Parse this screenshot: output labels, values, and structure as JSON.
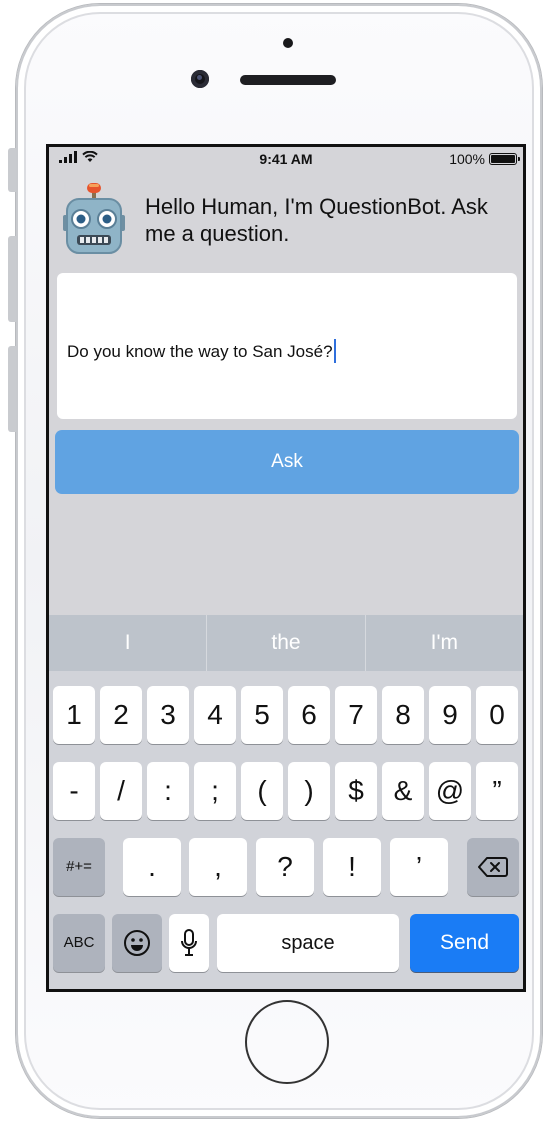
{
  "status_bar": {
    "time": "9:41 AM",
    "battery_percent": "100%",
    "icons": [
      "signal-bars-icon",
      "wifi-icon",
      "battery-icon"
    ]
  },
  "bot": {
    "avatar": "robot-face-icon",
    "greeting": "Hello Human, I'm QuestionBot. Ask me a question."
  },
  "question": {
    "value": "Do you know the way to San José?"
  },
  "ask_button": {
    "label": "Ask",
    "color": "#60a3e2"
  },
  "keyboard": {
    "suggestions": [
      "I",
      "the",
      "I'm"
    ],
    "row1": [
      "1",
      "2",
      "3",
      "4",
      "5",
      "6",
      "7",
      "8",
      "9",
      "0"
    ],
    "row2": [
      "-",
      "/",
      ":",
      ";",
      "(",
      ")",
      "$",
      "&",
      "@",
      "”"
    ],
    "row3": {
      "mode_key": "#+=",
      "keys": [
        ".",
        ",",
        "?",
        "!",
        "’"
      ],
      "delete_icon": "backspace-icon"
    },
    "row4": {
      "abc_key": "ABC",
      "emoji_icon": "emoji-icon",
      "mic_icon": "microphone-icon",
      "space_label": "space",
      "send_label": "Send",
      "send_color": "#1a7cf5"
    }
  }
}
